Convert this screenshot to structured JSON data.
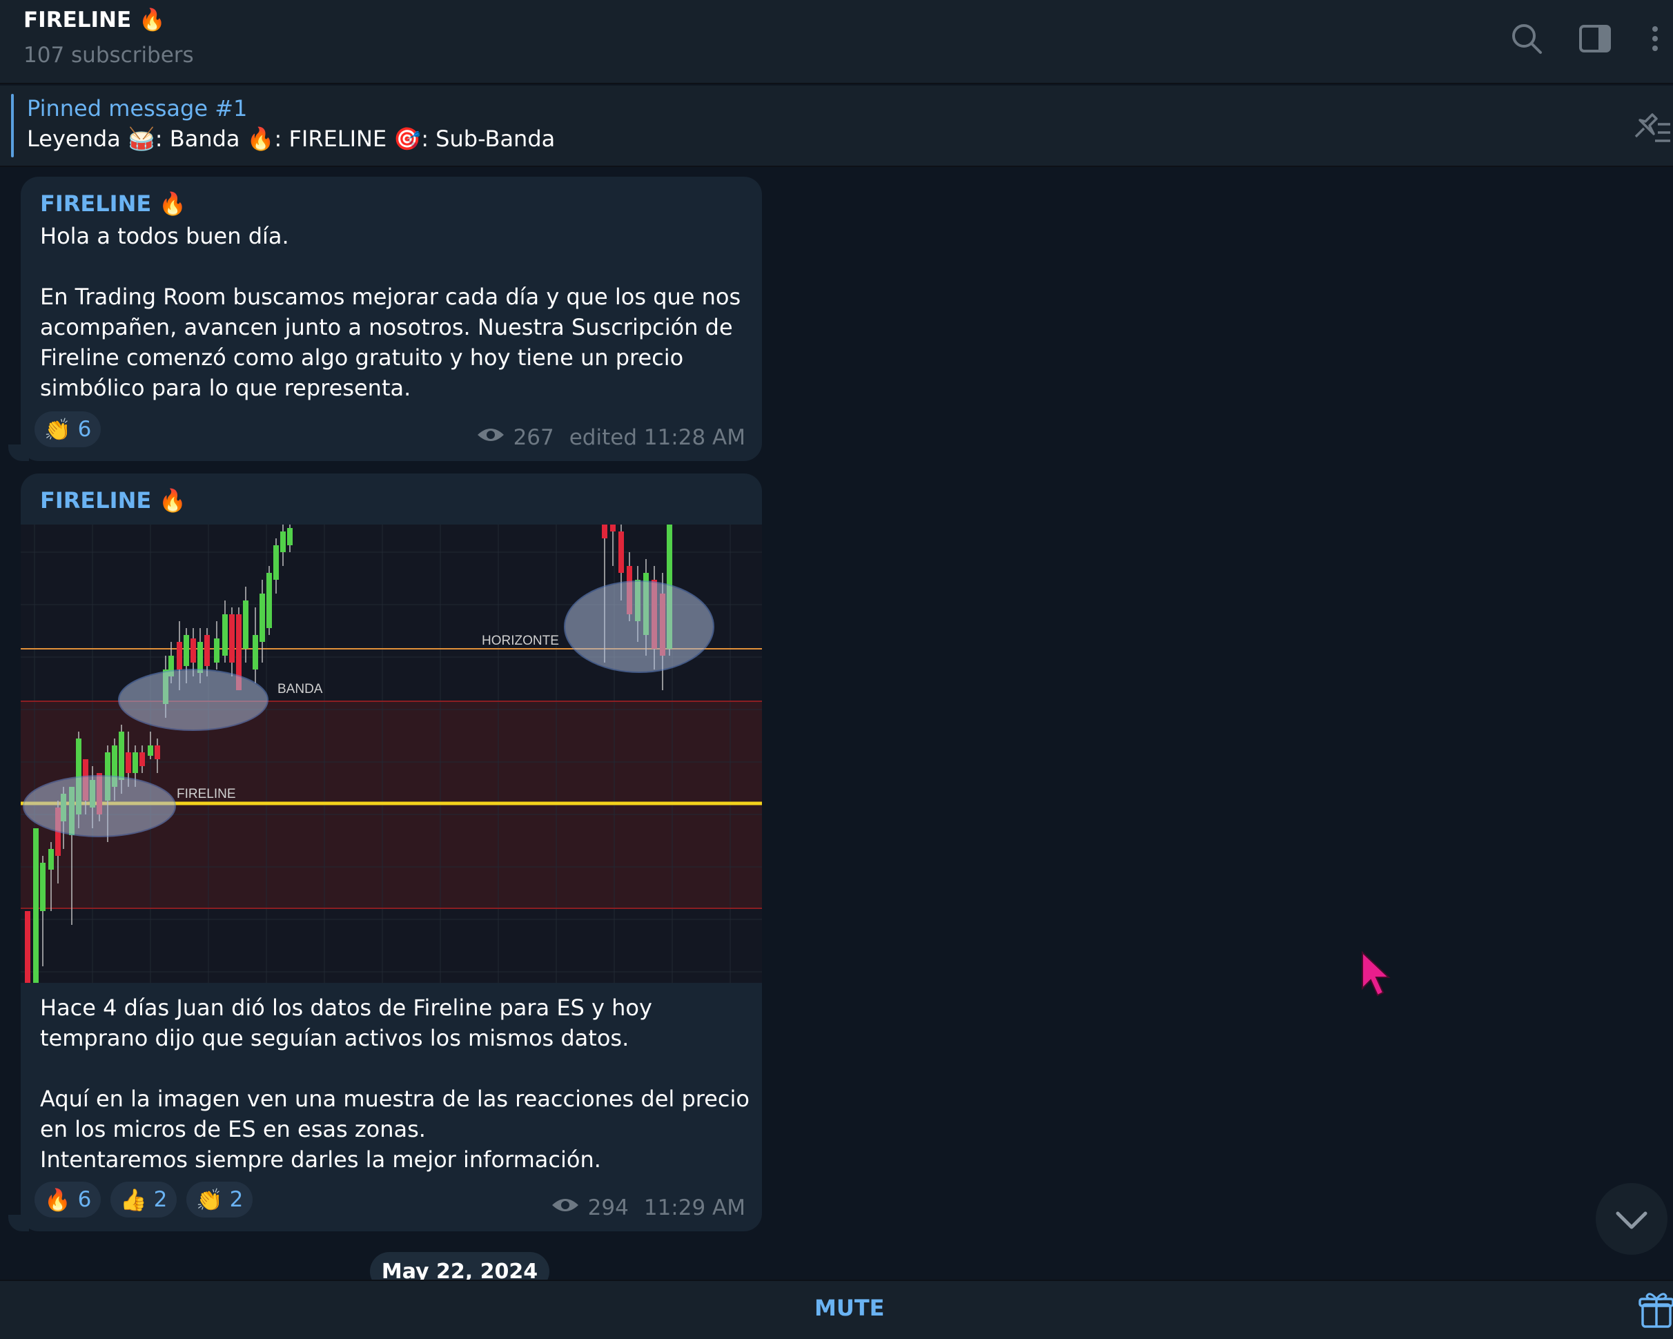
{
  "header": {
    "title": "FIRELINE 🔥",
    "subtitle": "107 subscribers",
    "icons": [
      "search-icon",
      "sidebar-toggle-icon",
      "more-vertical-icon"
    ]
  },
  "pinned": {
    "title": "Pinned message #1",
    "text": "Leyenda 🥁: Banda  🔥: FIRELINE  🎯: Sub-Banda"
  },
  "messages": [
    {
      "sender": "FIRELINE 🔥",
      "text": "Hola a todos buen día.\n\nEn Trading Room buscamos mejorar cada día y que los que nos acompañen, avancen junto a nosotros. Nuestra Suscripción de Fireline comenzó como algo gratuito y hoy tiene un precio simbólico para lo que representa.",
      "reactions": [
        {
          "emoji": "👏",
          "count": "6"
        }
      ],
      "views": "267",
      "time": "edited 11:28 AM"
    },
    {
      "sender": "FIRELINE 🔥",
      "image_labels": {
        "horizonte": "HORIZONTE",
        "banda": "BANDA",
        "fireline": "FIRELINE"
      },
      "text": "Hace 4 días Juan dió los datos de Fireline para ES y hoy temprano dijo que seguían activos los mismos datos.\n\nAquí en la imagen ven una muestra de las reacciones del precio en los micros de ES en esas zonas.\nIntentaremos siempre darles la mejor información.",
      "reactions": [
        {
          "emoji": "🔥",
          "count": "6"
        },
        {
          "emoji": "👍",
          "count": "2"
        },
        {
          "emoji": "👏",
          "count": "2"
        }
      ],
      "views": "294",
      "time": "11:29 AM"
    }
  ],
  "date_separator": "May 22, 2024",
  "bottom": {
    "mute_label": "MUTE"
  },
  "colors": {
    "accent": "#6ab3f3",
    "bg": "#0e1621",
    "panel": "#17212b",
    "bubble": "#182533",
    "cursor": "#e91e8c"
  }
}
